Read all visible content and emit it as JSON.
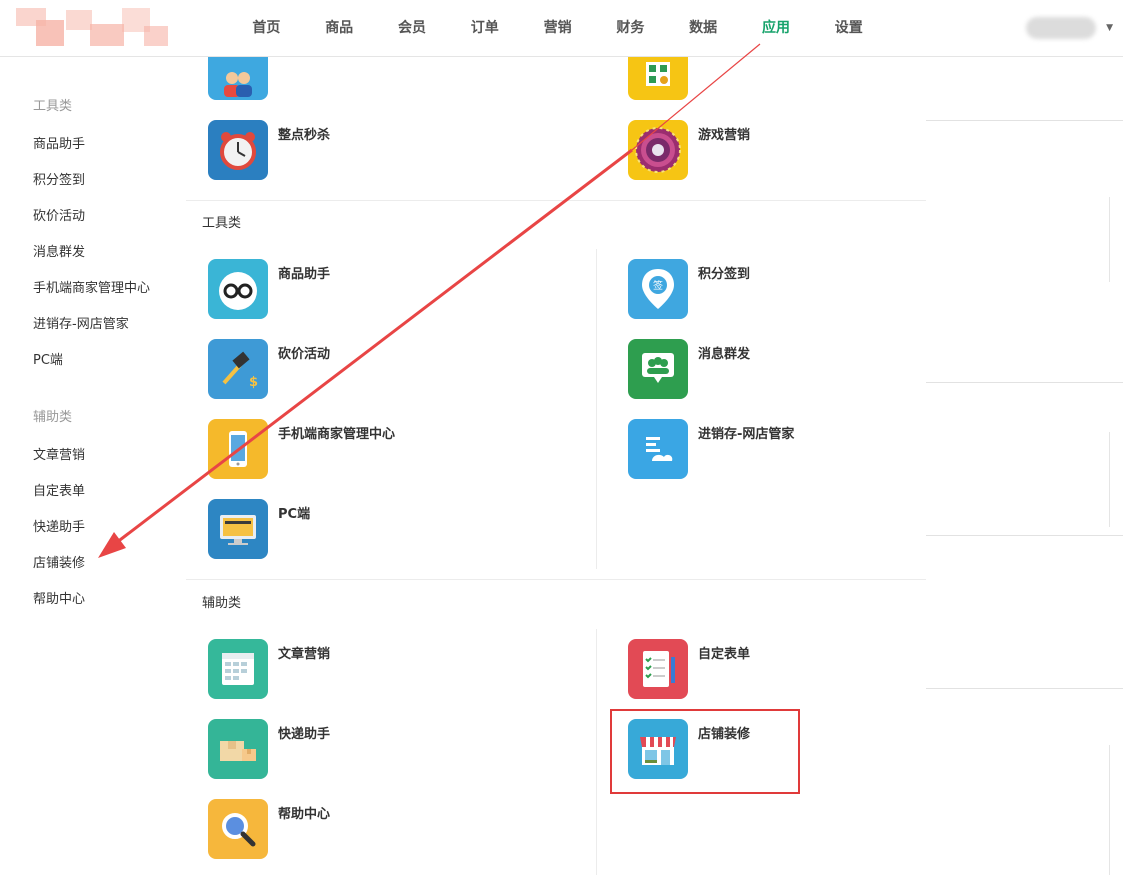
{
  "header": {
    "nav": [
      "首页",
      "商品",
      "会员",
      "订单",
      "营销",
      "财务",
      "数据",
      "应用",
      "设置"
    ],
    "active_nav": "应用",
    "accent_color": "#17a36b"
  },
  "sidebar": {
    "groups": [
      {
        "title": "工具类",
        "items": [
          "商品助手",
          "积分签到",
          "砍价活动",
          "消息群发",
          "手机端商家管理中心",
          "进销存-网店管家",
          "PC端"
        ]
      },
      {
        "title": "辅助类",
        "items": [
          "文章营销",
          "自定表单",
          "快递助手",
          "店铺装修",
          "帮助中心"
        ]
      }
    ]
  },
  "main": {
    "top_apps": [
      {
        "label": "整点秒杀",
        "icon": "alarm-clock-icon",
        "color": "#2b7fc0"
      },
      {
        "label": "游戏营销",
        "icon": "prize-wheel-icon",
        "color": "#f6c514"
      }
    ],
    "sections": [
      {
        "title": "工具类",
        "apps": [
          {
            "label": "商品助手",
            "icon": "glasses-face-icon",
            "color": "#3ab5d6"
          },
          {
            "label": "积分签到",
            "icon": "sign-in-pin-icon",
            "color": "#3fa7e0"
          },
          {
            "label": "砍价活动",
            "icon": "hammer-dollar-icon",
            "color": "#3e9ad6"
          },
          {
            "label": "消息群发",
            "icon": "group-message-icon",
            "color": "#2e9e4f"
          },
          {
            "label": "手机端商家管理中心",
            "icon": "smartphone-icon",
            "color": "#f5b92b"
          },
          {
            "label": "进销存-网店管家",
            "icon": "inventory-icon",
            "color": "#3aa6e4"
          },
          {
            "label": "PC端",
            "icon": "desktop-monitor-icon",
            "color": "#2d86c3"
          }
        ]
      },
      {
        "title": "辅助类",
        "apps": [
          {
            "label": "文章营销",
            "icon": "article-grid-icon",
            "color": "#35b89a"
          },
          {
            "label": "自定表单",
            "icon": "checklist-form-icon",
            "color": "#e24a55"
          },
          {
            "label": "快递助手",
            "icon": "parcel-box-icon",
            "color": "#34b597"
          },
          {
            "label": "店铺装修",
            "icon": "storefront-icon",
            "color": "#37a9d8"
          },
          {
            "label": "帮助中心",
            "icon": "magnifier-icon",
            "color": "#f6b73c"
          }
        ]
      }
    ]
  }
}
